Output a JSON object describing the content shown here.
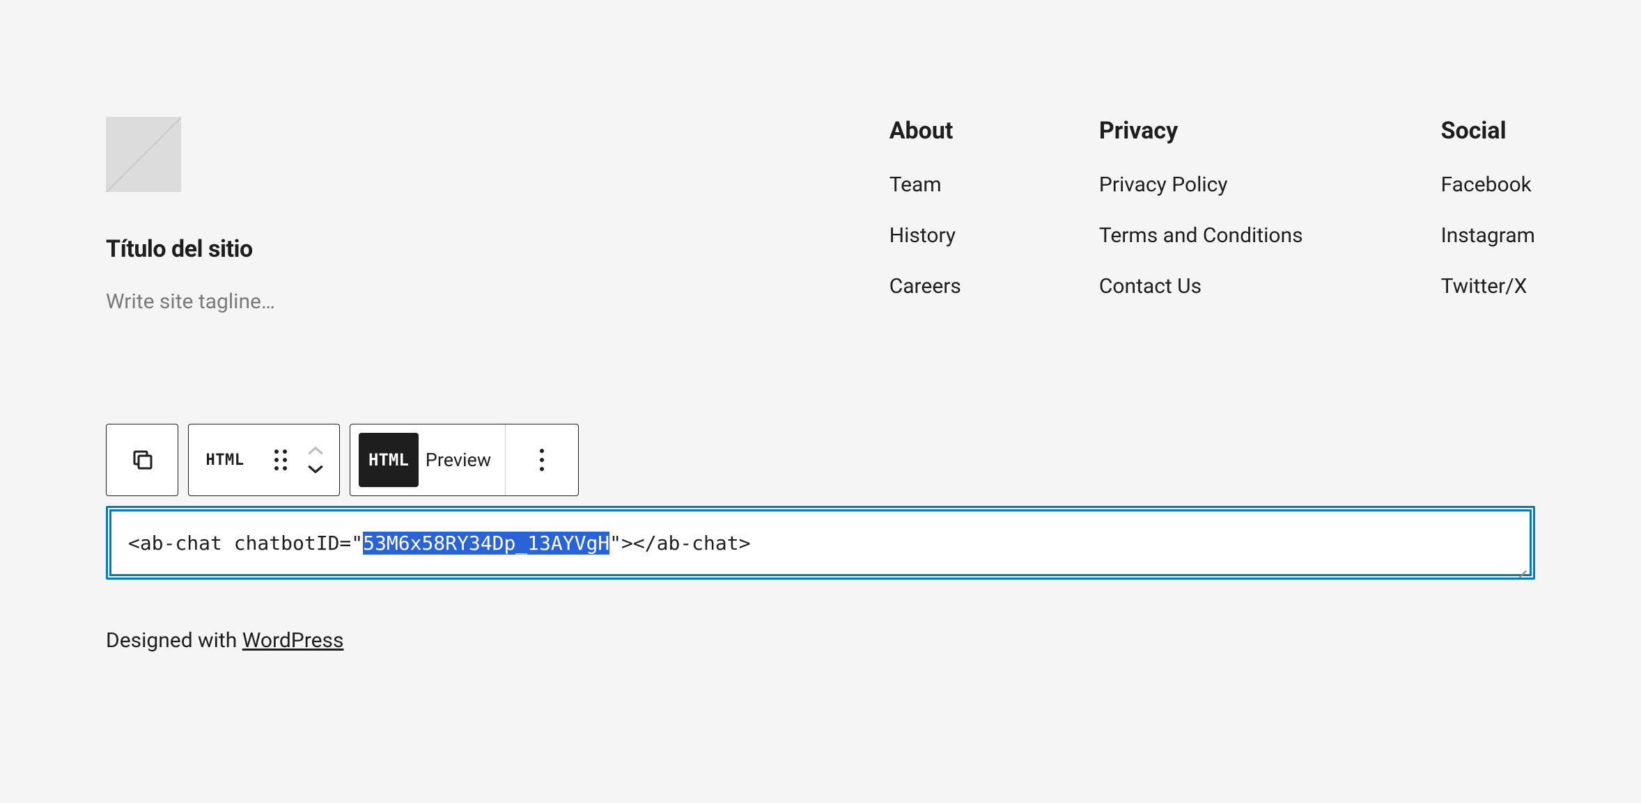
{
  "site": {
    "title": "Título del sitio",
    "tagline_placeholder": "Write site tagline…"
  },
  "nav": {
    "about": {
      "heading": "About",
      "items": [
        "Team",
        "History",
        "Careers"
      ]
    },
    "privacy": {
      "heading": "Privacy",
      "items": [
        "Privacy Policy",
        "Terms and Conditions",
        "Contact Us"
      ]
    },
    "social": {
      "heading": "Social",
      "items": [
        "Facebook",
        "Instagram",
        "Twitter/X"
      ]
    }
  },
  "toolbar": {
    "html_badge": "HTML",
    "html_pill": "HTML",
    "preview_label": "Preview"
  },
  "code": {
    "prefix": "<ab-chat chatbotID=\"",
    "selected": "53M6x58RY34Dp_13AYVgH",
    "suffix": "\"></ab-chat>"
  },
  "footer": {
    "text": "Designed with ",
    "link": "WordPress"
  }
}
